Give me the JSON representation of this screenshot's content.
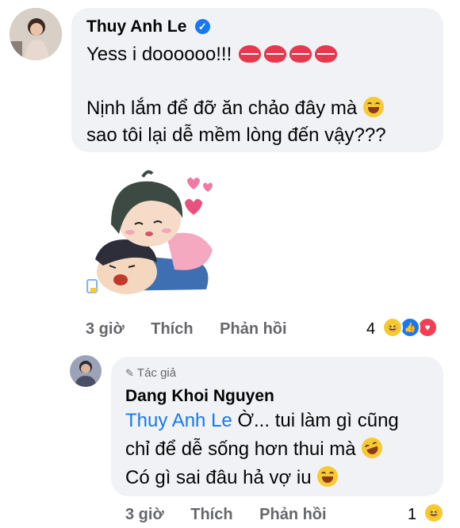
{
  "comment1": {
    "author": "Thuy Anh Le",
    "line1": "Yess i doooooo!!!",
    "line2": "Nịnh lắm để đỡ ăn chảo đây mà",
    "line3": "sao tôi lại dễ mềm lòng đến vậy???",
    "time": "3 giờ",
    "like": "Thích",
    "reply": "Phản hồi",
    "reaction_count": "4"
  },
  "comment2": {
    "badge": "Tác giả",
    "author": "Dang Khoi Nguyen",
    "mention": "Thuy Anh Le",
    "line1": "Ờ... tui làm gì cũng",
    "line2": "chỉ để dễ sống hơn thui mà",
    "line3": "Có gì sai đâu hả vợ iu",
    "time": "3 giờ",
    "like": "Thích",
    "reply": "Phản hồi",
    "reaction_count": "1"
  },
  "colors": {
    "bubble": "#f0f2f5",
    "meta": "#65676b",
    "mention": "#1877f2"
  }
}
